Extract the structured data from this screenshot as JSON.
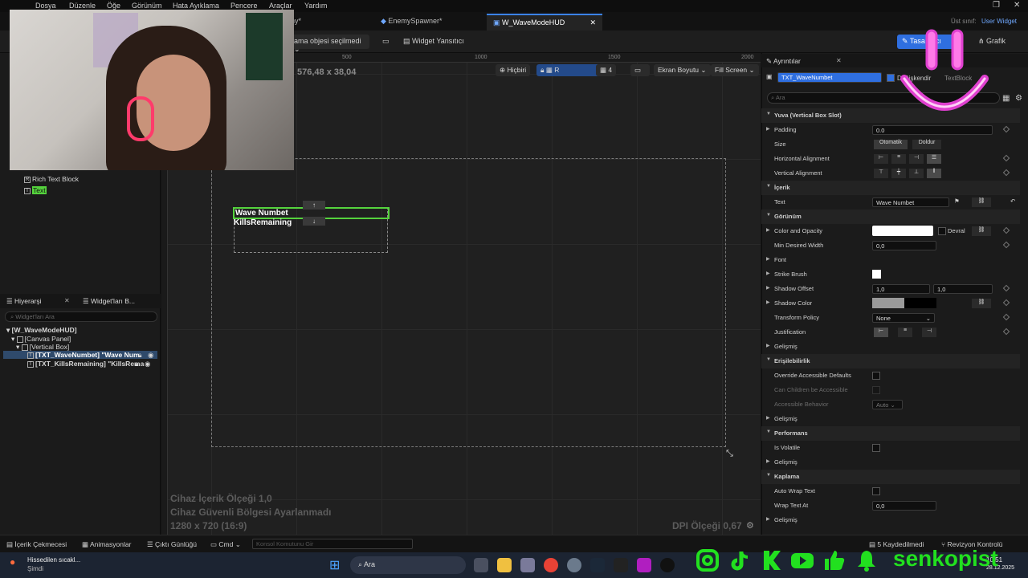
{
  "menubar": {
    "items": [
      "Dosya",
      "Düzenle",
      "Öğe",
      "Görünüm",
      "Hata Ayıklama",
      "Pencere",
      "Araçlar",
      "Yardım"
    ],
    "parent_class_label": "Üst sınıf:",
    "parent_class_value": "User Widget"
  },
  "tabs": [
    {
      "label": "ny*"
    },
    {
      "label": "EnemySpawner*"
    },
    {
      "label": "W_WaveModeHUD"
    }
  ],
  "toolbar": {
    "selection_dropdown": "ama objesi seçilmedi",
    "reflector": "Widget Yansıtıcı",
    "designer": "Tasarımcı",
    "graph": "Grafik"
  },
  "palette": {
    "rich_text_block": "Rich Text Block",
    "text": "Text"
  },
  "hierarchy": {
    "tab_label": "Hiyerarşi",
    "widgets_tab_label": "Widget'ları B...",
    "search_placeholder": "Widget'ları Ara",
    "rows": [
      "[W_WaveModeHUD]",
      "[Canvas Panel]",
      "[Vertical Box]",
      "[TXT_WaveNumbet] \"Wave Num",
      "[TXT_KillsRemaining] \"KillsRema"
    ]
  },
  "viewport": {
    "size_readout": "576,48 x 38,04",
    "ruler_ticks": [
      "500",
      "1000",
      "1500",
      "2000"
    ],
    "none_btn": "Hiçbiri",
    "r_btn": "R",
    "grid_value": "4",
    "screen_size": "Ekran Boyutu",
    "fill_screen": "Fill Screen",
    "wave_text": "Wave Numbet",
    "kills_text": "KillsRemaining",
    "overlay_scale": "Cihaz İçerik Ölçeği 1,0",
    "overlay_safe": "Cihaz Güvenli Bölgesi Ayarlanmadı",
    "overlay_res": "1280 x 720 (16:9)",
    "dpi_scale": "DPI Ölçeği 0,67"
  },
  "details": {
    "tab_label": "Ayrıntılar",
    "widget_name": "TXT_WaveNumbet",
    "variable_label": "Değişkendir",
    "class_label": "TextBlock",
    "search_placeholder": "Ara",
    "sections": {
      "slot": "Yuva (Vertical Box Slot)",
      "content": "İçerik",
      "appearance": "Görünüm",
      "accessibility": "Erişilebilirlik",
      "performance": "Performans",
      "wrapping": "Kaplama"
    },
    "props": {
      "padding": "Padding",
      "padding_val": "0.0",
      "size": "Size",
      "size_auto": "Otomatik",
      "size_fill": "Doldur",
      "h_align": "Horizontal Alignment",
      "v_align": "Vertical Alignment",
      "text": "Text",
      "text_val": "Wave Numbet",
      "color_opacity": "Color and Opacity",
      "inherit": "Devral",
      "min_width": "Min Desired Width",
      "min_width_val": "0,0",
      "font": "Font",
      "strike": "Strike Brush",
      "shadow_offset": "Shadow Offset",
      "shadow_x": "1,0",
      "shadow_y": "1,0",
      "shadow_color": "Shadow Color",
      "transform_policy": "Transform Policy",
      "transform_val": "None",
      "justification": "Justification",
      "advanced": "Gelişmiş",
      "override_access": "Override Accessible Defaults",
      "children_access": "Can Children be Accessible",
      "access_behavior": "Accessible Behavior",
      "access_behavior_val": "Auto",
      "is_volatile": "Is Volatile",
      "auto_wrap": "Auto Wrap Text",
      "wrap_at": "Wrap Text At",
      "wrap_at_val": "0,0"
    }
  },
  "statusbar": {
    "content_drawer": "İçerik Çekmecesi",
    "animations": "Animasyonlar",
    "output_log": "Çıktı Günlüğü",
    "cmd": "Cmd",
    "console_placeholder": "Konsol Komutunu Gir",
    "saved": "5 Kaydedilmedi",
    "revision": "Revizyon Kontrolü"
  },
  "taskbar": {
    "weather": "Hissedilen sıcakl...",
    "weather_sub": "Şimdi",
    "search": "Ara",
    "time": "10:51",
    "date": "28.12.2025",
    "watermark": "senkopist"
  },
  "colors": {
    "accent": "#3b82f6",
    "selection_green": "#55d33d",
    "logo_pink": "#e040d0",
    "social_green": "#22e01f"
  }
}
